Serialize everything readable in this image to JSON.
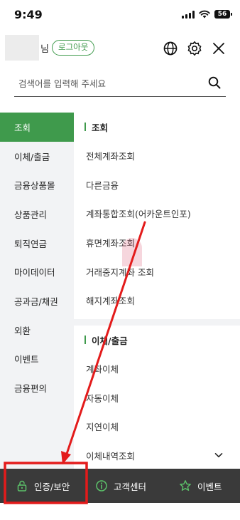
{
  "status_bar": {
    "time": "9:49",
    "battery": "56"
  },
  "header": {
    "user_suffix": "님",
    "logout_label": "로그아웃"
  },
  "search": {
    "placeholder": "검색어를 입력해 주세요"
  },
  "sidebar": {
    "items": [
      {
        "label": "조회",
        "active": true
      },
      {
        "label": "이체/출금"
      },
      {
        "label": "금융상품몰"
      },
      {
        "label": "상품관리"
      },
      {
        "label": "퇴직연금"
      },
      {
        "label": "마이데이터"
      },
      {
        "label": "공과금/채권"
      },
      {
        "label": "외환"
      },
      {
        "label": "이벤트"
      },
      {
        "label": "금융편의"
      }
    ]
  },
  "content": {
    "sections": [
      {
        "title": "조회",
        "items": [
          "전체계좌조회",
          "다른금융",
          "계좌통합조회(어카운트인포)",
          "휴면계좌조회",
          "거래중지계좌 조회",
          "해지계좌조회"
        ]
      },
      {
        "title": "이체/출금",
        "items": [
          "계좌이체",
          "자동이체",
          "지연이체",
          "이체내역조회"
        ]
      }
    ]
  },
  "bottom_bar": {
    "auth_label": "인증/보안",
    "center_label": "고객센터",
    "event_label": "이벤트"
  },
  "colors": {
    "accent": "#3f9a4c",
    "annotation": "#e31b1b",
    "bottom_bar": "#3a3a3a"
  },
  "icons": [
    "globe-icon",
    "gear-icon",
    "close-icon",
    "search-icon",
    "lock-icon",
    "info-icon",
    "star-icon",
    "chevron-down-icon"
  ]
}
